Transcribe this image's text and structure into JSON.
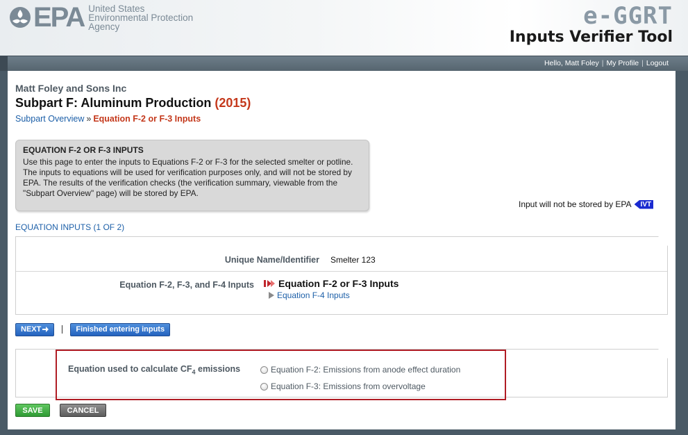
{
  "header": {
    "logo_text": "EPA",
    "agency_line1": "United States",
    "agency_line2": "Environmental Protection",
    "agency_line3": "Agency",
    "app_name": "e-GGRT",
    "tool_name": "Inputs Verifier Tool"
  },
  "user_links": {
    "greeting": "Hello, Matt Foley",
    "profile": "My Profile",
    "logout": "Logout",
    "separator": "|"
  },
  "page": {
    "company": "Matt Foley and Sons Inc",
    "title": "Subpart F: Aluminum Production",
    "year": "(2015)",
    "breadcrumb": {
      "link": "Subpart Overview",
      "separator": "»",
      "current": "Equation F-2 or F-3 Inputs"
    }
  },
  "infobox": {
    "title": "EQUATION F-2 OR F-3 INPUTS",
    "body": "Use this page to enter the inputs to Equations F-2 or F-3 for the selected smelter or potline. The inputs to equations will be used for verification purposes only, and will not be stored by EPA. The results of the verification checks (the verification summary, viewable from the \"Subpart Overview\" page) will be stored by EPA."
  },
  "ivt_note": {
    "text": "Input will not be stored by EPA",
    "badge": "IVT"
  },
  "section_label": "EQUATION INPUTS (1 OF 2)",
  "form": {
    "unique_name_label": "Unique Name/Identifier",
    "unique_name_value": "Smelter 123",
    "equation_inputs_label": "Equation F-2, F-3, and F-4 Inputs",
    "current_equation": "Equation F-2 or F-3 Inputs",
    "other_equation_link": "Equation F-4 Inputs"
  },
  "buttons": {
    "next": "NEXT",
    "finished": "Finished entering inputs",
    "save": "SAVE",
    "cancel": "CANCEL"
  },
  "equation_choice": {
    "label_prefix": "Equation used to calculate CF",
    "label_sub": "4",
    "label_suffix": " emissions",
    "options": [
      "Equation F-2: Emissions from anode effect duration",
      "Equation F-3: Emissions from overvoltage"
    ]
  },
  "colors": {
    "accent_red": "#c4381b",
    "link_blue": "#1c5fa8",
    "highlight_border": "#b01c24"
  }
}
